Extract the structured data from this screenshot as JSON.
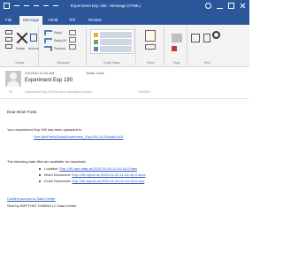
{
  "window": {
    "title": "Experiment Exp 190 - Message (HTML)"
  },
  "ribbon": {
    "tabs": [
      "File",
      "Message",
      "Ashdt",
      "Tell",
      "Review"
    ],
    "groups": [
      "Delete",
      "Respond",
      "Quick Steps",
      "Move",
      "Tags",
      "Find"
    ],
    "buttons": {
      "delete": "Delete",
      "archive": "Archive",
      "reply": "Reply",
      "reply_all": "Reply All",
      "forward": "Forward",
      "meeting": "Meeting",
      "im": "IM",
      "more": "More",
      "move": "Move",
      "rules": "Rules",
      "tags": "Tags",
      "translate": "Translate",
      "search": "Search",
      "zoom": "Zoom"
    }
  },
  "message": {
    "date": "1/9/2020 11:04 AM",
    "from": "Brian Forte",
    "subject": "Experiment Exp 190",
    "to": "To",
    "preview_line": "Experiment Exp 190 has been uploaded to folder",
    "received_time": "1/9/2020"
  },
  "body": {
    "greeting": "Dear Brian Forte,",
    "ready_text": "Your experiment Exp 190 has been uploaded to",
    "experiment_url": "See-Me/Prefix/Data/Experiment_Exp190-20-09Data-U4D",
    "available_text": "The following data files are available for download:",
    "files": [
      {
        "label": "Location:",
        "link": "Exp-190-raw-data-at-2020-01-09-11-04-18-0.html"
      },
      {
        "label": "Word Document:",
        "link": "Exp-190-report-at-2020-01-09-11-04-18-0.docx"
      },
      {
        "label": "Excel Document:",
        "link": "Exp-190-report-at-2020-01-09-11-04-18-0.xlsx"
      }
    ],
    "sign_link": "Confirm access to Data Center",
    "sign_sent": "Sent by INFFTHAT CHAINS LC Data Center"
  }
}
